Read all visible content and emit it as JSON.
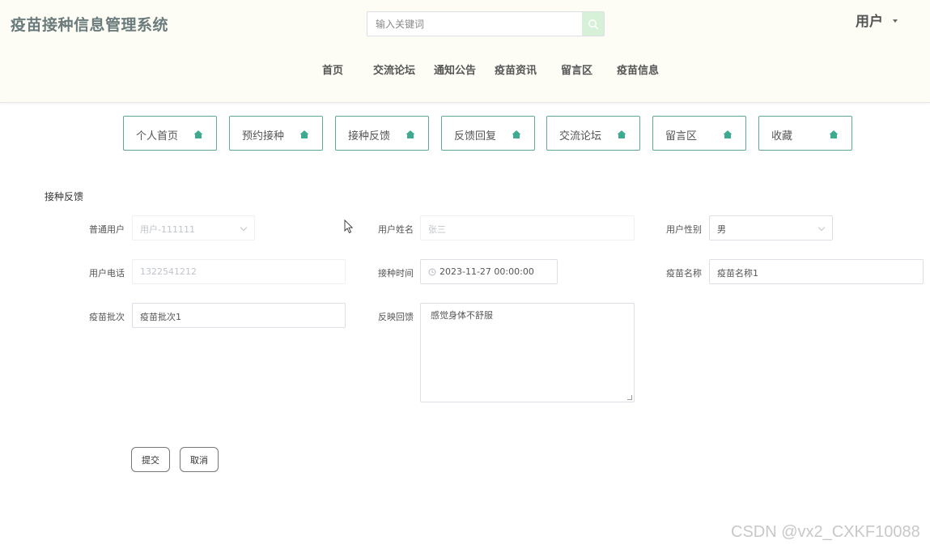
{
  "header": {
    "site_title": "疫苗接种信息管理系统",
    "search_placeholder": "输入关键词",
    "user_label": "用户"
  },
  "nav": [
    "首页",
    "交流论坛",
    "通知公告",
    "疫苗资讯",
    "留言区",
    "疫苗信息"
  ],
  "tabs": [
    "个人首页",
    "预约接种",
    "接种反馈",
    "反馈回复",
    "交流论坛",
    "留言区",
    "收藏"
  ],
  "form": {
    "section_title": "接种反馈",
    "ordinary_user_label": "普通用户",
    "ordinary_user_value": "用户-111111",
    "user_name_label": "用户姓名",
    "user_name_value": "张三",
    "user_gender_label": "用户性别",
    "user_gender_value": "男",
    "user_phone_label": "用户电话",
    "user_phone_value": "1322541212",
    "vaccination_time_label": "接种时间",
    "vaccination_time_value": "2023-11-27 00:00:00",
    "vaccine_name_label": "疫苗名称",
    "vaccine_name_value": "疫苗名称1",
    "vaccine_batch_label": "疫苗批次",
    "vaccine_batch_value": "疫苗批次1",
    "feedback_label": "反映回馈",
    "feedback_value": "感觉身体不舒服"
  },
  "actions": {
    "submit": "提交",
    "cancel": "取消"
  },
  "watermark": "CSDN @vx2_CXKF10088",
  "colors": {
    "accent": "#5fa897",
    "search_button": "#d7f0d8",
    "header_bg": "#fdfdf6"
  }
}
